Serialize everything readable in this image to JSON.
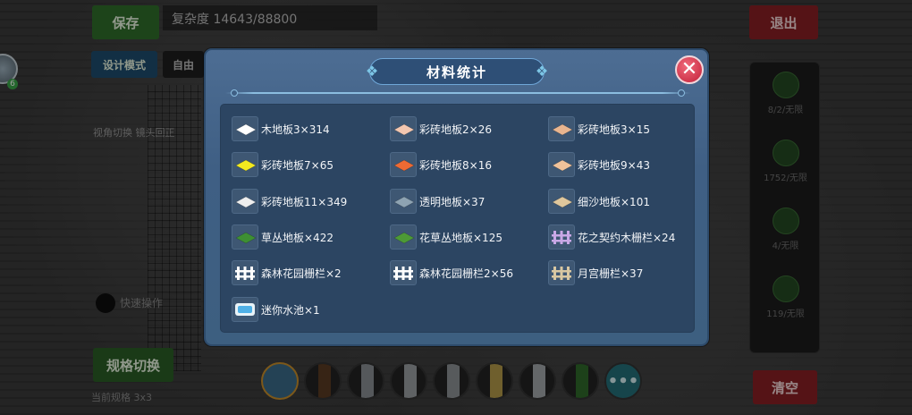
{
  "background": {
    "save_label": "保存",
    "complexity_text": "复杂度 14643/88800",
    "exit_label": "退出",
    "design_mode_label": "设计模式",
    "free_mode_label": "自由",
    "left_label": "视角切换 镜头回正",
    "dark_dot_label": "快速操作",
    "spec_switch_label": "规格切换",
    "bottom_label": "当前规格 3x3",
    "clear_label": "清空",
    "left_badge": "6",
    "right_panel_items": [
      "8/2/无限",
      "1752/无限",
      "4/无限",
      "119/无限"
    ],
    "toolbar_more": "•••"
  },
  "modal": {
    "title": "材料统计",
    "close_symbol": "✕",
    "materials": [
      {
        "label": "木地板3×314",
        "icon": "white-floor-tile-icon",
        "color": "#ffffff"
      },
      {
        "label": "彩砖地板2×26",
        "icon": "pink-floor-tile-icon",
        "color": "#f3c7b0"
      },
      {
        "label": "彩砖地板3×15",
        "icon": "tan-floor-tile-icon",
        "color": "#e9b58f"
      },
      {
        "label": "彩砖地板7×65",
        "icon": "yellow-floor-tile-icon",
        "color": "#f3ea1f"
      },
      {
        "label": "彩砖地板8×16",
        "icon": "orange-floor-tile-icon",
        "color": "#ee6a33"
      },
      {
        "label": "彩砖地板9×43",
        "icon": "peach-floor-tile-icon",
        "color": "#f0c29a"
      },
      {
        "label": "彩砖地板11×349",
        "icon": "light-floor-tile-icon",
        "color": "#eeeeee"
      },
      {
        "label": "透明地板×37",
        "icon": "transparent-floor-tile-icon",
        "color": "#8ea3b2"
      },
      {
        "label": "细沙地板×101",
        "icon": "sand-floor-tile-icon",
        "color": "#e0c79c"
      },
      {
        "label": "草丛地板×422",
        "icon": "grass-floor-tile-icon",
        "color": "#3e8f33"
      },
      {
        "label": "花草丛地板×125",
        "icon": "flower-grass-floor-tile-icon",
        "color": "#4d9a36"
      },
      {
        "label": "花之契约木栅栏×24",
        "icon": "flower-fence-icon",
        "color": "#c9a8e6"
      },
      {
        "label": "森林花园栅栏×2",
        "icon": "white-fence-icon",
        "color": "#ffffff"
      },
      {
        "label": "森林花园栅栏2×56",
        "icon": "white-fence-2-icon",
        "color": "#ffffff"
      },
      {
        "label": "月宫栅栏×37",
        "icon": "moon-fence-icon",
        "color": "#d8c7a2"
      },
      {
        "label": "迷你水池×1",
        "icon": "mini-pool-icon",
        "color": "#4fb0e6"
      }
    ]
  }
}
